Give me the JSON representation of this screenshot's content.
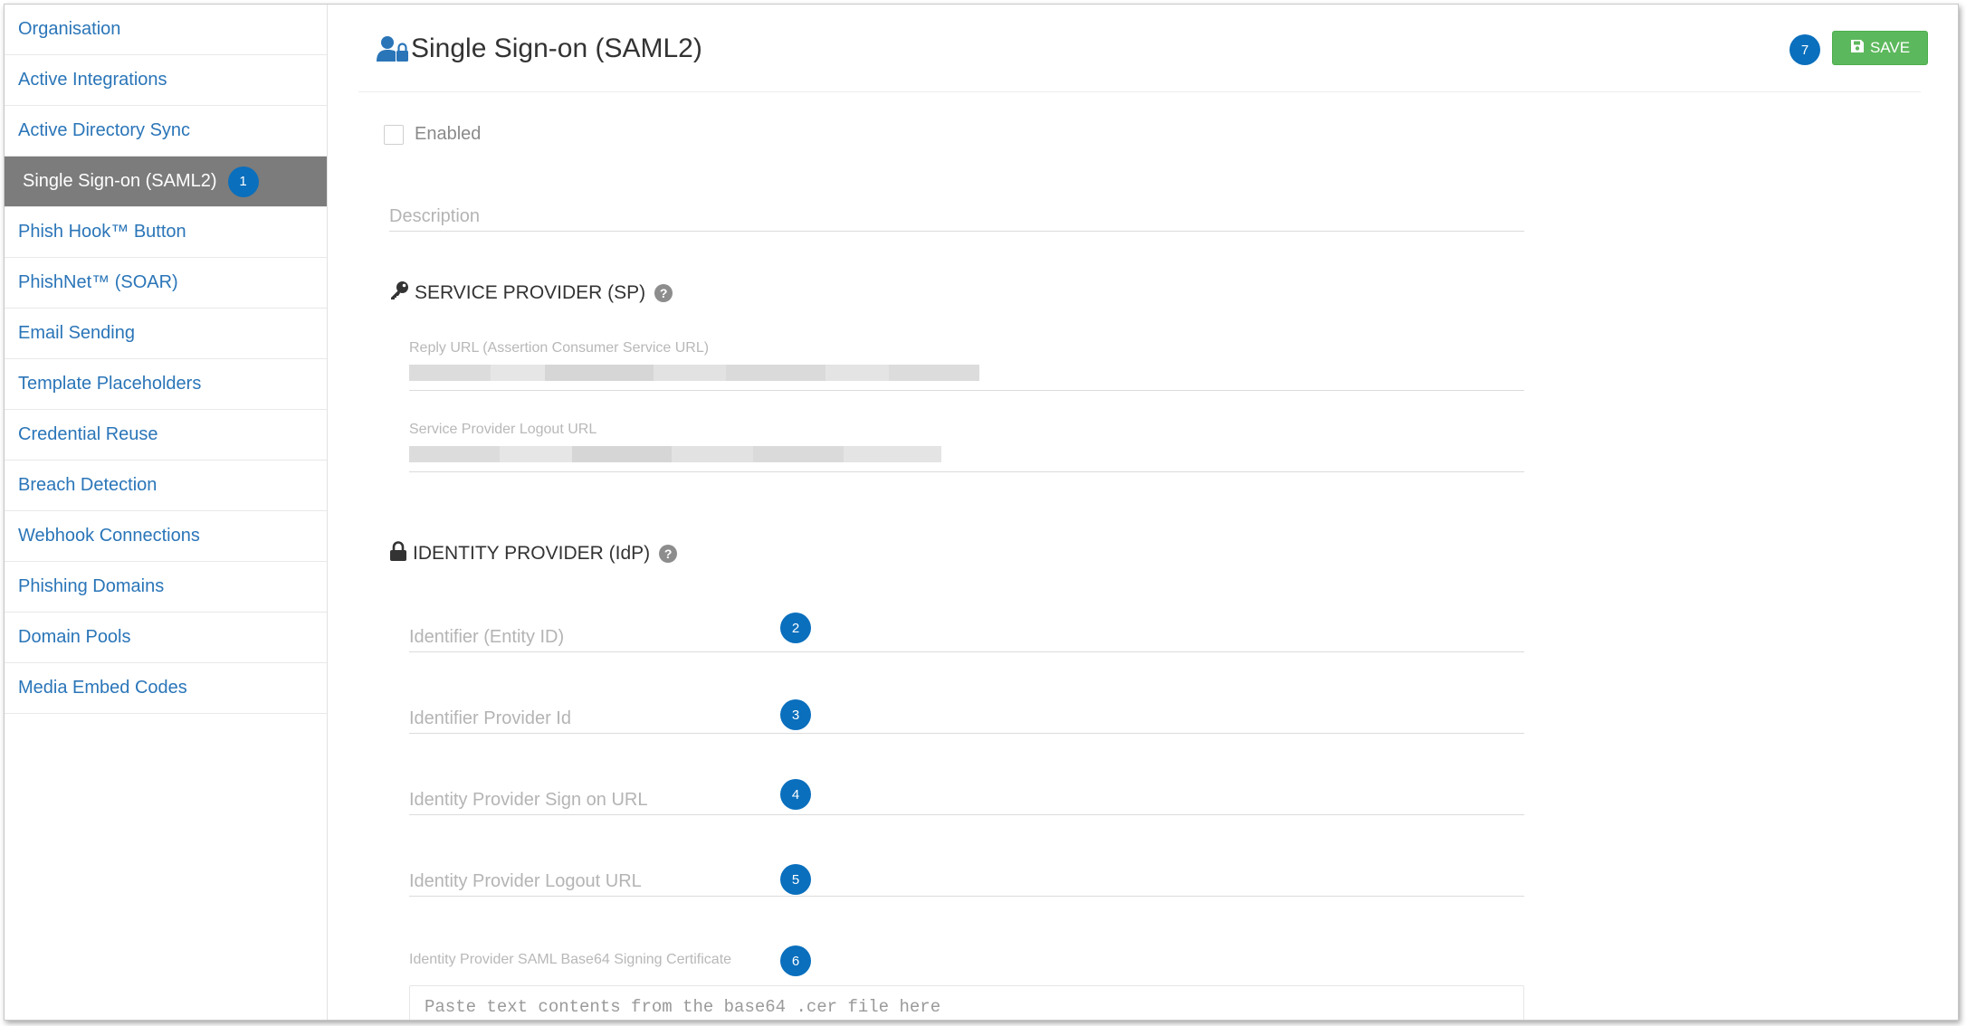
{
  "sidebar": {
    "items": [
      {
        "label": "Organisation"
      },
      {
        "label": "Active Integrations"
      },
      {
        "label": "Active Directory Sync"
      },
      {
        "label": "Single Sign-on (SAML2)",
        "active": true,
        "badge": "1"
      },
      {
        "label": "Phish Hook™ Button"
      },
      {
        "label": "PhishNet™ (SOAR)"
      },
      {
        "label": "Email Sending"
      },
      {
        "label": "Template Placeholders"
      },
      {
        "label": "Credential Reuse"
      },
      {
        "label": "Breach Detection"
      },
      {
        "label": "Webhook Connections"
      },
      {
        "label": "Phishing Domains"
      },
      {
        "label": "Domain Pools"
      },
      {
        "label": "Media Embed Codes"
      }
    ]
  },
  "header": {
    "title": "Single Sign-on (SAML2)",
    "title_icon": "user-lock-icon",
    "save_badge": "7",
    "save_label": "SAVE",
    "save_icon": "floppy-disk-icon"
  },
  "form": {
    "enabled_label": "Enabled",
    "description_placeholder": "Description",
    "sp_section": {
      "title": "SERVICE PROVIDER (SP)",
      "icon": "key-icon",
      "reply_url_label": "Reply URL (Assertion Consumer Service URL)",
      "logout_url_label": "Service Provider Logout URL"
    },
    "idp_section": {
      "title": "IDENTITY PROVIDER (IdP)",
      "icon": "lock-icon",
      "fields": [
        {
          "placeholder": "Identifier (Entity ID)",
          "badge": "2"
        },
        {
          "placeholder": "Identifier Provider Id",
          "badge": "3"
        },
        {
          "placeholder": "Identity Provider Sign on URL",
          "badge": "4"
        },
        {
          "placeholder": "Identity Provider Logout URL",
          "badge": "5"
        }
      ],
      "cert_label": "Identity Provider SAML Base64 Signing Certificate",
      "cert_badge": "6",
      "cert_placeholder": "Paste text contents from the base64 .cer file here"
    }
  },
  "colors": {
    "link": "#2a75b8",
    "active_bg": "#7c7c7c",
    "badge": "#0a6fbd",
    "save": "#5cb85c"
  }
}
